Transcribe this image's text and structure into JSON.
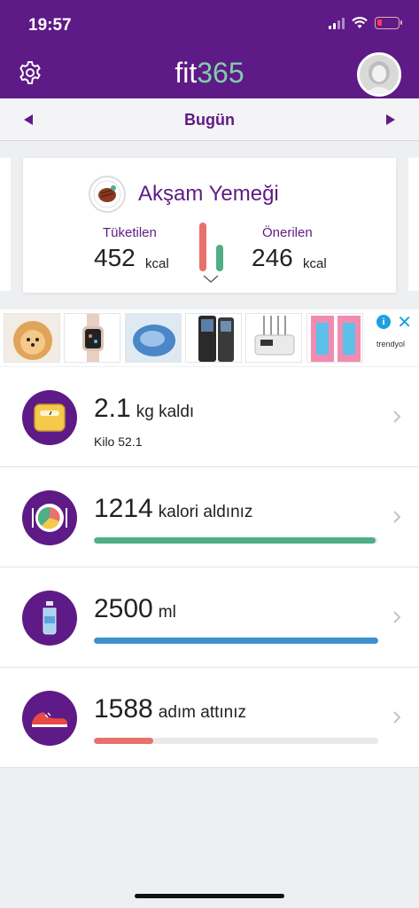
{
  "status_bar": {
    "time": "19:57"
  },
  "header": {
    "logo_fit": "fit",
    "logo_num": "365"
  },
  "day_nav": {
    "label": "Bugün"
  },
  "meal_card": {
    "title": "Akşam Yemeği",
    "consumed_label": "Tüketilen",
    "consumed_value": "452",
    "recommended_label": "Önerilen",
    "recommended_value": "246",
    "unit": "kcal"
  },
  "ad": {
    "brand": "trendyol"
  },
  "rows": [
    {
      "value": "2.1",
      "unit": "kg kaldı",
      "sub": "Kilo 52.1"
    },
    {
      "value": "1214",
      "unit": "kalori aldınız",
      "progress": 0.99,
      "color": "#4fae85"
    },
    {
      "value": "2500",
      "unit": "ml",
      "progress": 1.0,
      "color": "#3d8fce"
    },
    {
      "value": "1588",
      "unit": "adım attınız",
      "progress": 0.21,
      "color": "#e8716b"
    }
  ],
  "colors": {
    "brand_purple": "#5e1a86",
    "accent_green": "#7fd0a8"
  }
}
